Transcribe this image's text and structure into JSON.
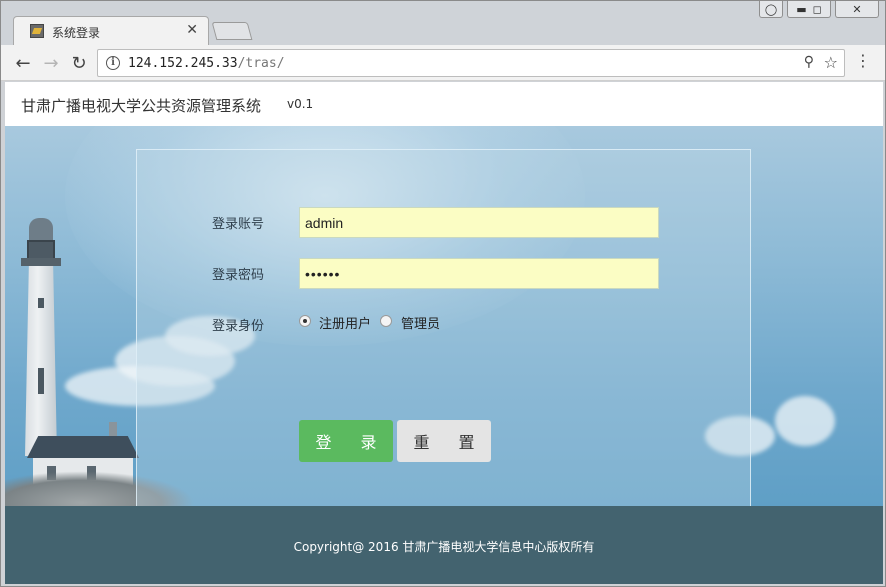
{
  "browser": {
    "tab_title": "系统登录",
    "tab_close_glyph": "✕",
    "url_host": "124.152.245.33",
    "url_path": "/tras/",
    "window_buttons": {
      "user": "👤",
      "minimize": "▭",
      "maximize": "◻",
      "close": "✕"
    }
  },
  "header": {
    "title": "甘肃广播电视大学公共资源管理系统",
    "version": "v0.1"
  },
  "form": {
    "account_label": "登录账号",
    "account_value": "admin",
    "password_label": "登录密码",
    "password_value": "••••••",
    "role_label": "登录身份",
    "role_options": [
      {
        "label": "注册用户",
        "checked": true
      },
      {
        "label": "管理员",
        "checked": false
      }
    ],
    "login_button": "登 录",
    "reset_button": "重 置"
  },
  "footer": {
    "copyright": "Copyright@ 2016 甘肃广播电视大学信息中心版权所有"
  },
  "colors": {
    "login_button": "#5bba5f",
    "reset_button": "#e4e4e4",
    "input_background": "#fbfdc4",
    "footer_background": "#43636f"
  }
}
